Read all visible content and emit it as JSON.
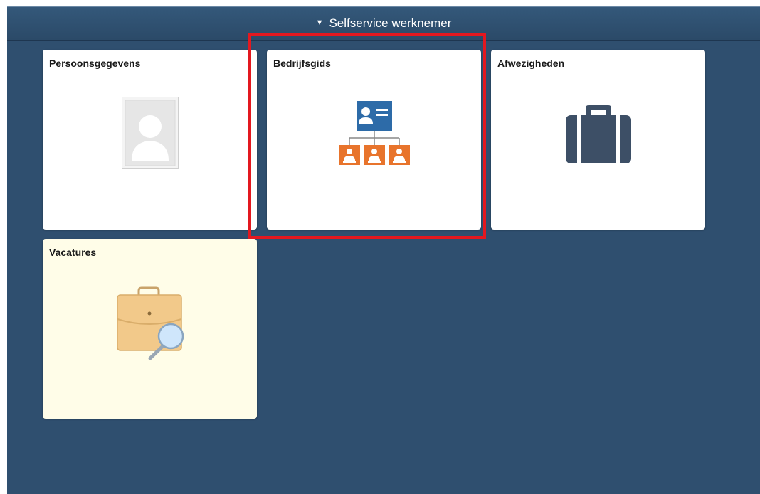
{
  "header": {
    "caret_icon": "triangle-down",
    "title": "Selfservice werknemer"
  },
  "tiles": [
    {
      "title": "Persoonsgegevens",
      "icon": "person-photo-placeholder-icon"
    },
    {
      "title": "Bedrijfsgids",
      "icon": "org-chart-icon",
      "highlighted": true
    },
    {
      "title": "Afwezigheden",
      "icon": "suitcase-icon"
    },
    {
      "title": "Vacatures",
      "icon": "briefcase-search-icon"
    }
  ],
  "colors": {
    "app_background": "#2f4f6f",
    "header_background": "#2b4a68",
    "tile_background": "#ffffff",
    "vacatures_tile_background": "#fffde8",
    "highlight": "#e3181f",
    "org_chart_blue": "#2d6ba8",
    "org_chart_orange": "#e8742c",
    "suitcase": "#3d4f66",
    "briefcase": "#f2c98a"
  }
}
